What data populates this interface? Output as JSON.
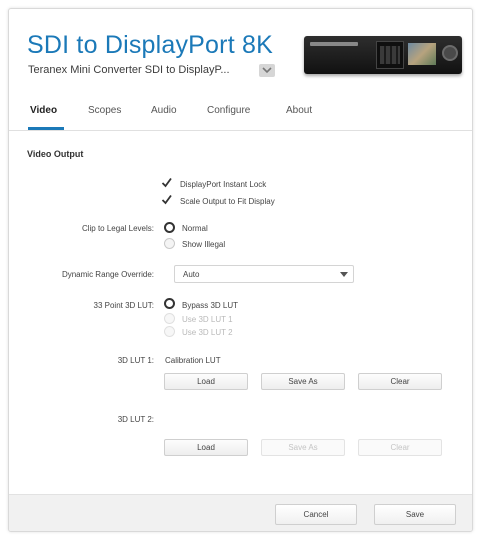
{
  "header": {
    "title": "SDI to DisplayPort 8K",
    "subtitle": "Teranex Mini Converter SDI to DisplayP..."
  },
  "tabs": [
    {
      "label": "Video",
      "active": true
    },
    {
      "label": "Scopes",
      "active": false
    },
    {
      "label": "Audio",
      "active": false
    },
    {
      "label": "Configure",
      "active": false
    },
    {
      "label": "About",
      "active": false
    }
  ],
  "video_output": {
    "section_title": "Video Output",
    "checkboxes": [
      {
        "label": "DisplayPort Instant Lock",
        "checked": true
      },
      {
        "label": "Scale Output to Fit Display",
        "checked": true
      }
    ],
    "clip_to_legal": {
      "label": "Clip to Legal Levels:",
      "options": [
        {
          "label": "Normal",
          "selected": true
        },
        {
          "label": "Show Illegal",
          "selected": false
        }
      ]
    },
    "dynamic_range": {
      "label": "Dynamic Range Override:",
      "value": "Auto"
    },
    "lut_33": {
      "label": "33 Point 3D LUT:",
      "options": [
        {
          "label": "Bypass 3D LUT",
          "selected": true,
          "enabled": true
        },
        {
          "label": "Use 3D LUT 1",
          "selected": false,
          "enabled": false
        },
        {
          "label": "Use 3D LUT 2",
          "selected": false,
          "enabled": false
        }
      ]
    },
    "lut1": {
      "label": "3D LUT 1:",
      "value": "Calibration LUT",
      "load": "Load",
      "save_as": "Save As",
      "clear": "Clear"
    },
    "lut2": {
      "label": "3D LUT 2:",
      "value": "",
      "load": "Load",
      "save_as": "Save As",
      "clear": "Clear"
    }
  },
  "footer": {
    "cancel": "Cancel",
    "save": "Save"
  },
  "colors": {
    "accent": "#1b79b8",
    "disabled_text": "#b9b9b9"
  },
  "icons": {
    "device": "converter-device-image",
    "subtitle_menu": "chevron-down-icon",
    "check": "checkmark-icon",
    "dropdown": "chevron-down-icon"
  }
}
